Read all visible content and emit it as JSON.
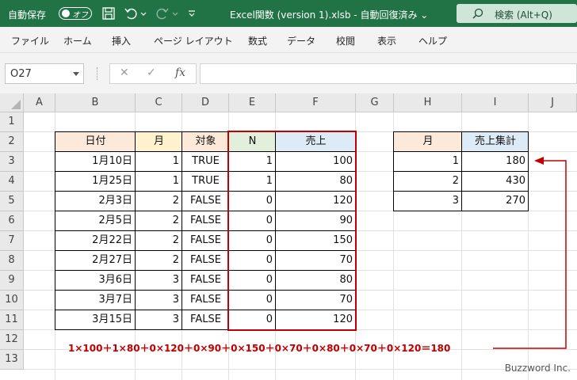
{
  "titlebar": {
    "autosave_label": "自動保存",
    "autosave_state": "オフ",
    "file_title": "Excel関数 (version 1).xlsb  -  自動回復済み  ⌄",
    "search_placeholder": "検索 (Alt+Q)",
    "save_icon": "save-icon",
    "undo_icon": "undo-icon",
    "redo_icon": "redo-icon",
    "customize_icon": "customize-icon"
  },
  "menu": [
    "ファイル",
    "ホーム",
    "挿入",
    "ページ レイアウト",
    "数式",
    "データ",
    "校閲",
    "表示",
    "ヘルプ"
  ],
  "formula_bar": {
    "namebox": "O27",
    "cancel": "✕",
    "enter": "✓",
    "fx": "fx",
    "value": ""
  },
  "columns": [
    "A",
    "B",
    "C",
    "D",
    "E",
    "F",
    "G",
    "H",
    "I",
    "J"
  ],
  "rows": [
    "1",
    "2",
    "3",
    "4",
    "5",
    "6",
    "7",
    "8",
    "9",
    "10",
    "11",
    "12",
    "13"
  ],
  "main_table": {
    "headers": [
      "日付",
      "月",
      "対象",
      "N",
      "売上"
    ],
    "header_colors": [
      "#fde9d9",
      "#fff2cc",
      "#fde9d9",
      "#e2efda",
      "#ddebf7"
    ],
    "rows": [
      [
        "1月10日",
        "1",
        "TRUE",
        "1",
        "100"
      ],
      [
        "1月25日",
        "1",
        "TRUE",
        "1",
        "80"
      ],
      [
        "2月3日",
        "2",
        "FALSE",
        "0",
        "120"
      ],
      [
        "2月5日",
        "2",
        "FALSE",
        "0",
        "90"
      ],
      [
        "2月22日",
        "2",
        "FALSE",
        "0",
        "150"
      ],
      [
        "2月27日",
        "2",
        "FALSE",
        "0",
        "70"
      ],
      [
        "3月6日",
        "3",
        "FALSE",
        "0",
        "80"
      ],
      [
        "3月7日",
        "3",
        "FALSE",
        "0",
        "70"
      ],
      [
        "3月15日",
        "3",
        "FALSE",
        "0",
        "120"
      ]
    ]
  },
  "summary_table": {
    "headers": [
      "月",
      "売上集計"
    ],
    "header_colors": [
      "#fde9d9",
      "#ddebf7"
    ],
    "rows": [
      [
        "1",
        "180"
      ],
      [
        "2",
        "430"
      ],
      [
        "3",
        "270"
      ]
    ]
  },
  "annotation": {
    "formula": "1×100＋1×80＋0×120＋0×90＋0×150＋0×70＋0×80＋0×70＋0×120＝180",
    "color": "#c00000"
  },
  "watermark": "Buzzword Inc."
}
